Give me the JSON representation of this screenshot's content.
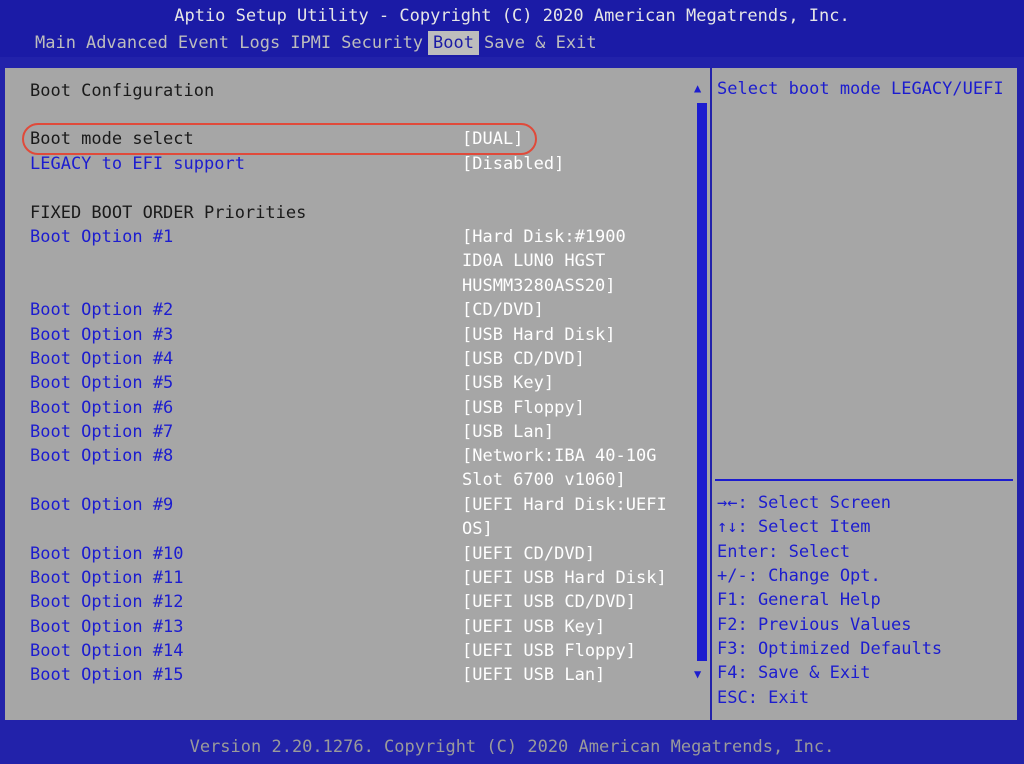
{
  "header": {
    "title": "Aptio Setup Utility - Copyright (C) 2020 American Megatrends, Inc.",
    "tabs": [
      "Main",
      "Advanced",
      "Event Logs",
      "IPMI",
      "Security",
      "Boot",
      "Save & Exit"
    ]
  },
  "main": {
    "section_title": "Boot Configuration",
    "boot_mode": {
      "label": "Boot mode select",
      "value": "[DUAL]"
    },
    "legacy_efi": {
      "label": "LEGACY to EFI support",
      "value": "[Disabled]"
    },
    "priorities_title": "FIXED BOOT ORDER Priorities",
    "options": [
      {
        "label": "Boot Option #1",
        "value": "[Hard Disk:#1900\nID0A LUN0 HGST\nHUSMM3280ASS20]"
      },
      {
        "label": "Boot Option #2",
        "value": "[CD/DVD]"
      },
      {
        "label": "Boot Option #3",
        "value": "[USB Hard Disk]"
      },
      {
        "label": "Boot Option #4",
        "value": "[USB CD/DVD]"
      },
      {
        "label": "Boot Option #5",
        "value": "[USB Key]"
      },
      {
        "label": "Boot Option #6",
        "value": "[USB Floppy]"
      },
      {
        "label": "Boot Option #7",
        "value": "[USB Lan]"
      },
      {
        "label": "Boot Option #8",
        "value": "[Network:IBA 40-10G\nSlot 6700 v1060]"
      },
      {
        "label": "Boot Option #9",
        "value": "[UEFI Hard Disk:UEFI\nOS]"
      },
      {
        "label": "Boot Option #10",
        "value": "[UEFI CD/DVD]"
      },
      {
        "label": "Boot Option #11",
        "value": "[UEFI USB Hard Disk]"
      },
      {
        "label": "Boot Option #12",
        "value": "[UEFI USB CD/DVD]"
      },
      {
        "label": "Boot Option #13",
        "value": "[UEFI USB Key]"
      },
      {
        "label": "Boot Option #14",
        "value": "[UEFI USB Floppy]"
      },
      {
        "label": "Boot Option #15",
        "value": "[UEFI USB Lan]"
      }
    ]
  },
  "help": {
    "text": "Select boot mode LEGACY/UEFI",
    "keys": [
      "→←: Select Screen",
      "↑↓: Select Item",
      "Enter: Select",
      "+/-: Change Opt.",
      "F1: General Help",
      "F2: Previous Values",
      "F3: Optimized Defaults",
      "F4: Save & Exit",
      "ESC: Exit"
    ]
  },
  "scrollbar": {
    "up_icon": "▲",
    "down_icon": "▼"
  },
  "footer": {
    "text": "Version 2.20.1276. Copyright (C) 2020 American Megatrends, Inc."
  }
}
